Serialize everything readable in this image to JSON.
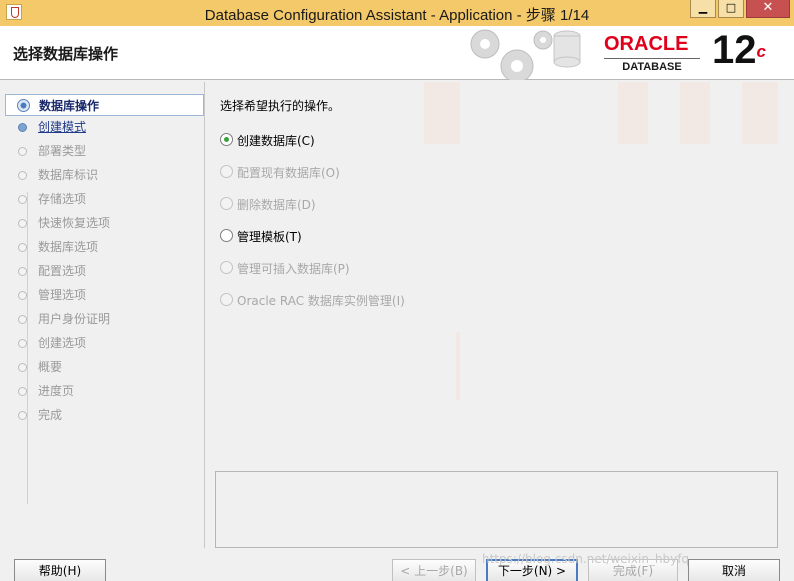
{
  "window": {
    "title": "Database Configuration Assistant - Application - 步骤 1/14"
  },
  "banner": {
    "heading": "选择数据库操作",
    "brand": "ORACLE",
    "brand_sub": "DATABASE",
    "version": "12",
    "version_suffix": "c"
  },
  "steps": [
    {
      "label": "数据库操作",
      "state": "active"
    },
    {
      "label": "创建模式",
      "state": "link"
    },
    {
      "label": "部署类型",
      "state": "disabled"
    },
    {
      "label": "数据库标识",
      "state": "disabled"
    },
    {
      "label": "存储选项",
      "state": "disabled"
    },
    {
      "label": "快速恢复选项",
      "state": "disabled"
    },
    {
      "label": "数据库选项",
      "state": "disabled"
    },
    {
      "label": "配置选项",
      "state": "disabled"
    },
    {
      "label": "管理选项",
      "state": "disabled"
    },
    {
      "label": "用户身份证明",
      "state": "disabled"
    },
    {
      "label": "创建选项",
      "state": "disabled"
    },
    {
      "label": "概要",
      "state": "disabled"
    },
    {
      "label": "进度页",
      "state": "disabled"
    },
    {
      "label": "完成",
      "state": "disabled"
    }
  ],
  "main": {
    "instruction": "选择希望执行的操作。",
    "options": [
      {
        "label": "创建数据库(C)",
        "selected": true,
        "enabled": true
      },
      {
        "label": "配置现有数据库(O)",
        "selected": false,
        "enabled": false
      },
      {
        "label": "删除数据库(D)",
        "selected": false,
        "enabled": false
      },
      {
        "label": "管理模板(T)",
        "selected": false,
        "enabled": true
      },
      {
        "label": "管理可插入数据库(P)",
        "selected": false,
        "enabled": false
      },
      {
        "label": "Oracle RAC 数据库实例管理(I)",
        "selected": false,
        "enabled": false
      }
    ]
  },
  "buttons": {
    "help": "帮助(H)",
    "back": "< 上一步(B)",
    "next": "下一步(N) >",
    "finish": "完成(F)",
    "cancel": "取消"
  },
  "watermark": "https://blog.csdn.net/weixin_hbyfq"
}
